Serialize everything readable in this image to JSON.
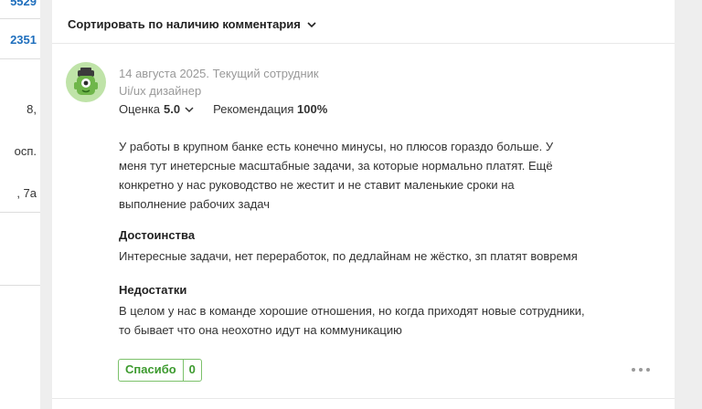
{
  "left_fragments": {
    "f1": "5529",
    "f2": "2351",
    "f3": "8,",
    "f4": "осп.",
    "f5": ", 7а"
  },
  "sort": {
    "label": "Сортировать по наличию комментария"
  },
  "review": {
    "date_line": "14 августа 2025. Текущий сотрудник",
    "position": "Ui/ux дизайнер",
    "rating_label": "Оценка",
    "rating_value": "5.0",
    "recommend_label": "Рекомендация",
    "recommend_value": "100%",
    "body": "У работы в крупном банке есть конечно минусы, но плюсов гораздо больше. У меня тут инетерсные масштабные задачи, за которые нормально платят. Ещё конкретно у нас руководство не жестит и не ставит маленькие сроки на выполнение рабочих задач",
    "pros_title": "Достоинства",
    "pros_text": "Интересные задачи, нет переработок, по дедлайнам не жёстко, зп платят вовремя",
    "cons_title": "Недостатки",
    "cons_text": "В целом у нас в команде хорошие отношения, но когда приходят новые сотрудники, то бывает что она неохотно идут на коммуникацию",
    "thanks_label": "Спасибо",
    "thanks_count": "0"
  },
  "colors": {
    "accent_green": "#3c9a2e",
    "link_blue": "#1f6fbd",
    "avatar_bg": "#bfe3a8"
  },
  "icons": {
    "sort": "chevron-down-icon",
    "rating": "chevron-down-icon",
    "avatar": "monster-avatar-icon",
    "more": "more-dots-icon"
  }
}
